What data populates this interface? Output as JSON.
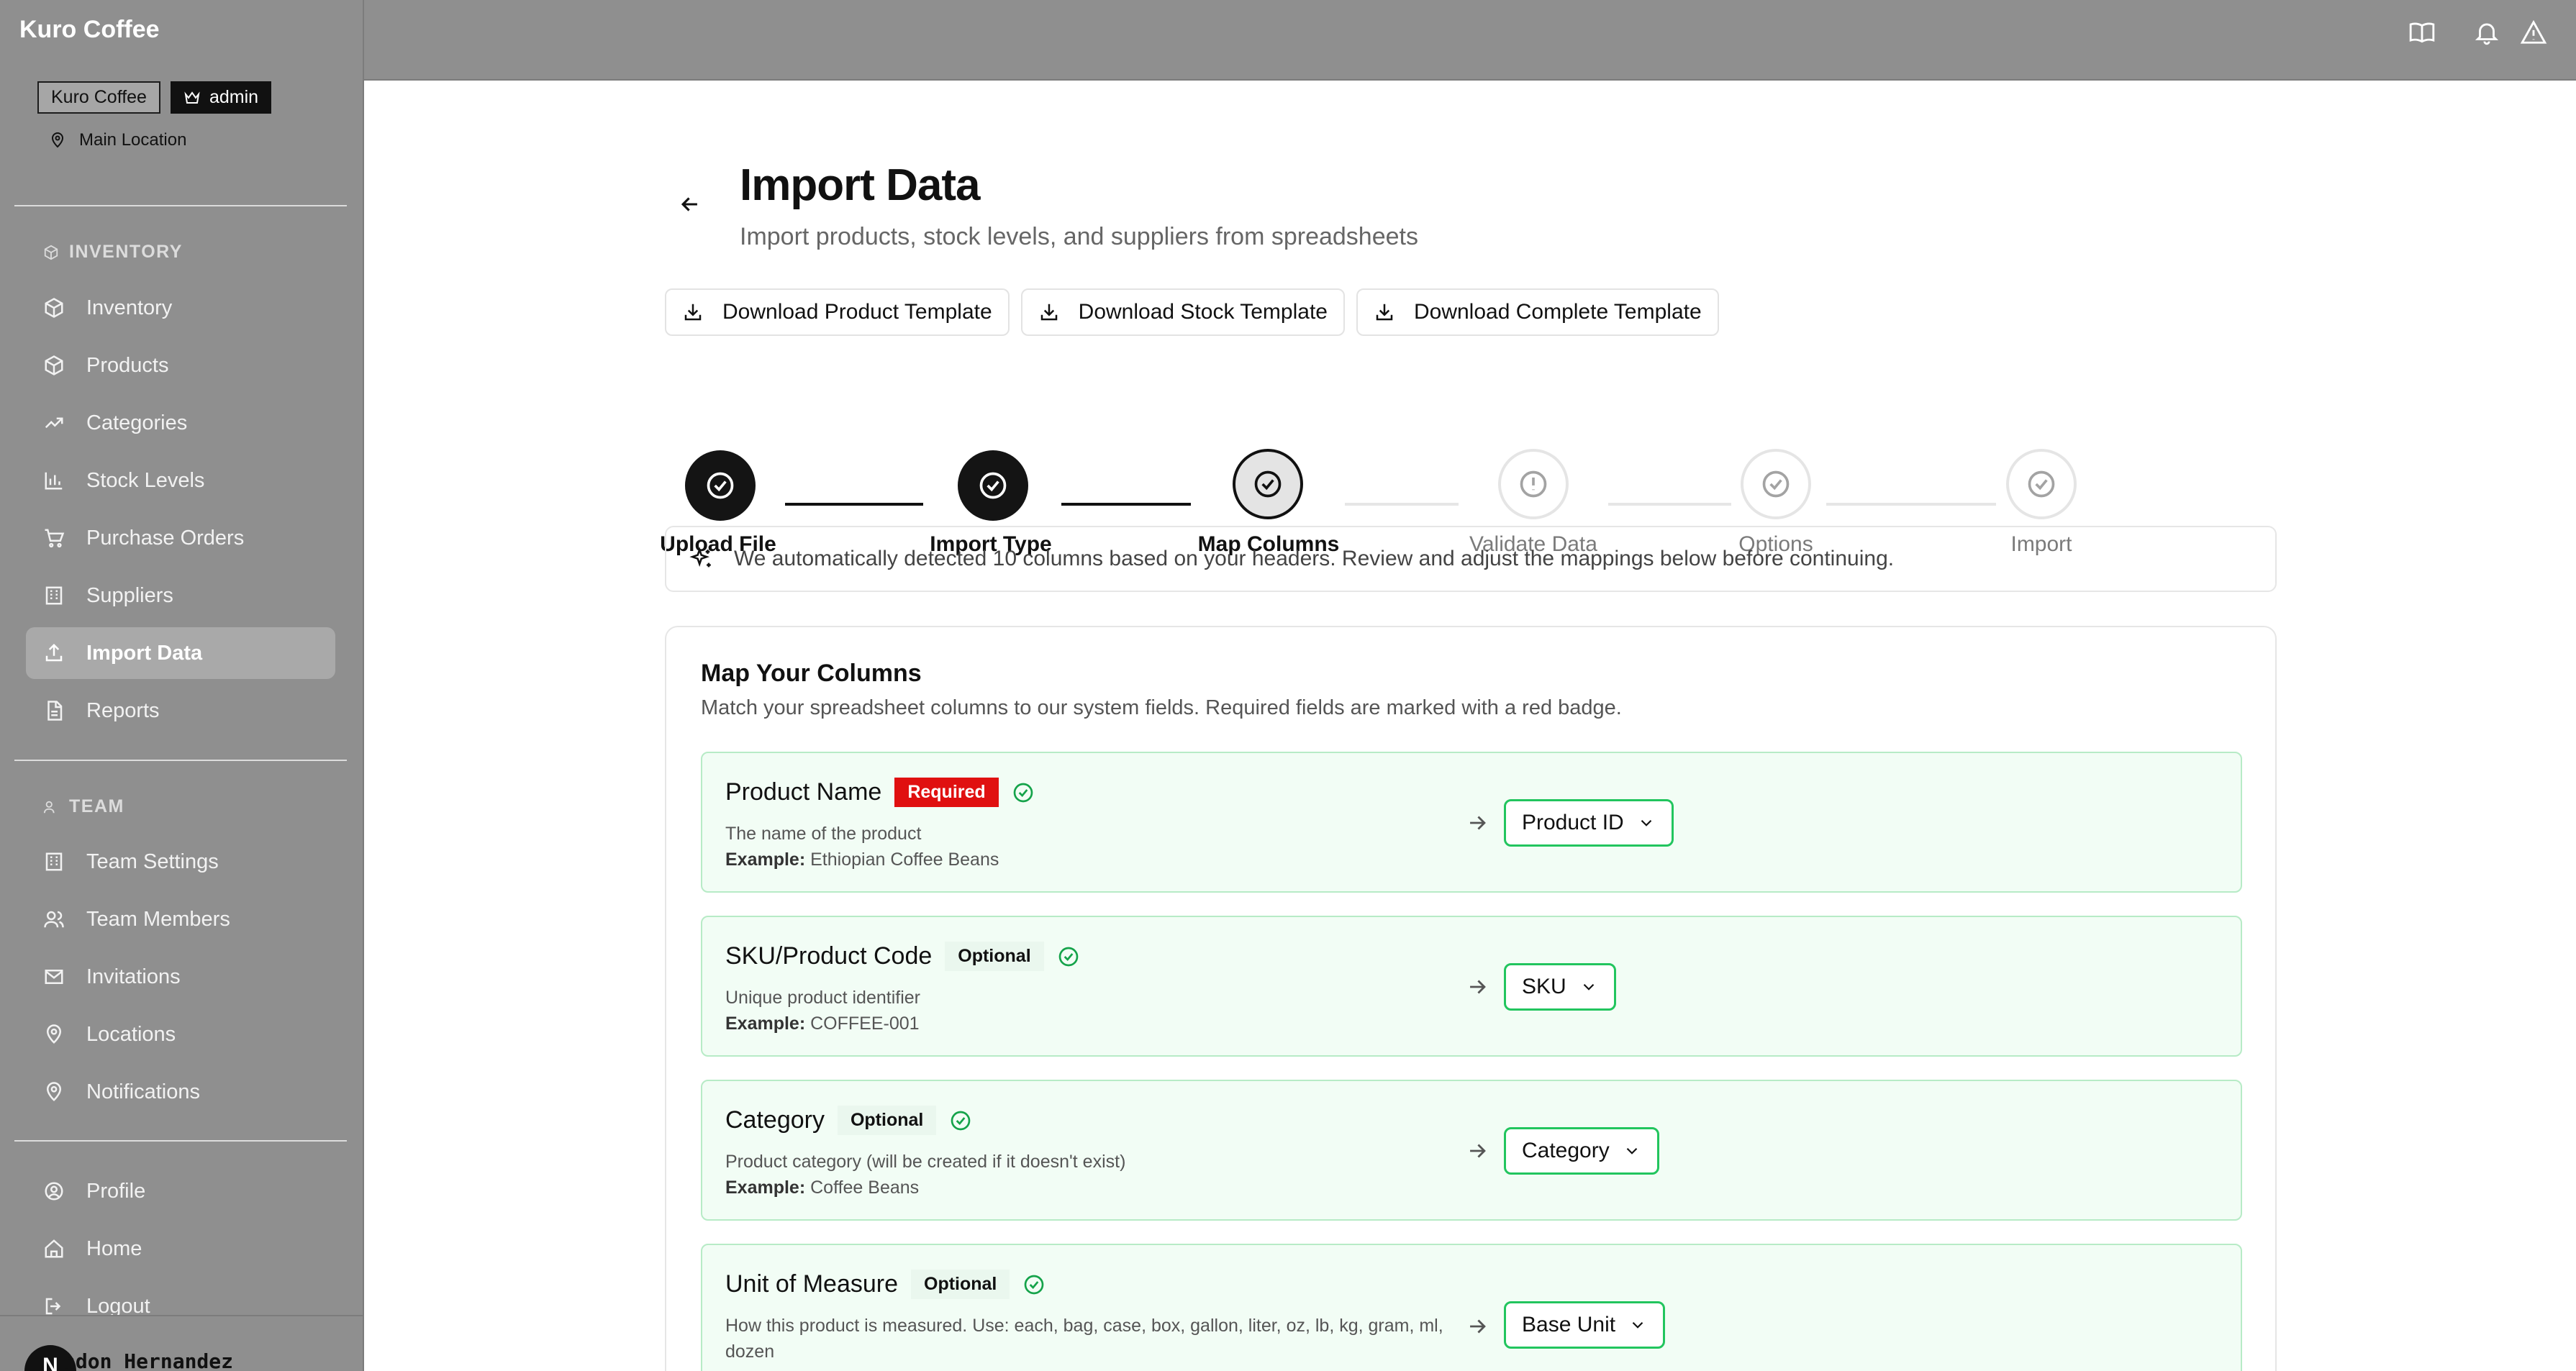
{
  "app": {
    "brand": "Kuro Coffee",
    "org_pill": "Kuro Coffee",
    "role_pill": "admin",
    "location": "Main Location"
  },
  "sidebar": {
    "section_inventory": "INVENTORY",
    "inventory_items": [
      {
        "label": "Inventory",
        "icon": "box-icon"
      },
      {
        "label": "Products",
        "icon": "box-icon"
      },
      {
        "label": "Categories",
        "icon": "trend-up-icon"
      },
      {
        "label": "Stock Levels",
        "icon": "bar-chart-icon"
      },
      {
        "label": "Purchase Orders",
        "icon": "cart-icon"
      },
      {
        "label": "Suppliers",
        "icon": "building-icon"
      },
      {
        "label": "Import Data",
        "icon": "upload-icon",
        "active": true
      },
      {
        "label": "Reports",
        "icon": "document-icon"
      }
    ],
    "section_team": "TEAM",
    "team_items": [
      {
        "label": "Team Settings",
        "icon": "building-icon"
      },
      {
        "label": "Team Members",
        "icon": "users-icon"
      },
      {
        "label": "Invitations",
        "icon": "mail-icon"
      },
      {
        "label": "Locations",
        "icon": "map-pin-icon"
      },
      {
        "label": "Notifications",
        "icon": "map-pin-icon"
      }
    ],
    "account_items": [
      {
        "label": "Profile",
        "icon": "user-circle-icon"
      },
      {
        "label": "Home",
        "icon": "home-icon"
      },
      {
        "label": "Logout",
        "icon": "logout-icon"
      }
    ],
    "user": {
      "initial": "N",
      "name": "ndon Hernandez"
    }
  },
  "topbar": {
    "icons": [
      "book-icon",
      "bell-icon",
      "alert-triangle-icon"
    ]
  },
  "page": {
    "title": "Import Data",
    "subtitle": "Import products, stock levels, and suppliers from spreadsheets",
    "template_buttons": [
      "Download Product Template",
      "Download Stock Template",
      "Download Complete Template"
    ],
    "steps": [
      {
        "label": "Upload File",
        "state": "done"
      },
      {
        "label": "Import Type",
        "state": "done"
      },
      {
        "label": "Map Columns",
        "state": "current"
      },
      {
        "label": "Validate Data",
        "state": "todo"
      },
      {
        "label": "Options",
        "state": "todo"
      },
      {
        "label": "Import",
        "state": "todo"
      }
    ],
    "banner": "We automatically detected 10 columns based on your headers. Review and adjust the mappings below before continuing.",
    "mapping": {
      "title": "Map Your Columns",
      "subtitle": "Match your spreadsheet columns to our system fields. Required fields are marked with a red badge.",
      "example_label": "Example:",
      "fields": [
        {
          "name": "Product Name",
          "badge": "Required",
          "description": "The name of the product",
          "example": "Ethiopian Coffee Beans",
          "selected": "Product ID"
        },
        {
          "name": "SKU/Product Code",
          "badge": "Optional",
          "description": "Unique product identifier",
          "example": "COFFEE-001",
          "selected": "SKU"
        },
        {
          "name": "Category",
          "badge": "Optional",
          "description": "Product category (will be created if it doesn't exist)",
          "example": "Coffee Beans",
          "selected": "Category"
        },
        {
          "name": "Unit of Measure",
          "badge": "Optional",
          "description": "How this product is measured. Use: each, bag, case, box, gallon, liter, oz, lb, kg, gram, ml, dozen",
          "example": "",
          "selected": "Base Unit"
        }
      ]
    }
  }
}
